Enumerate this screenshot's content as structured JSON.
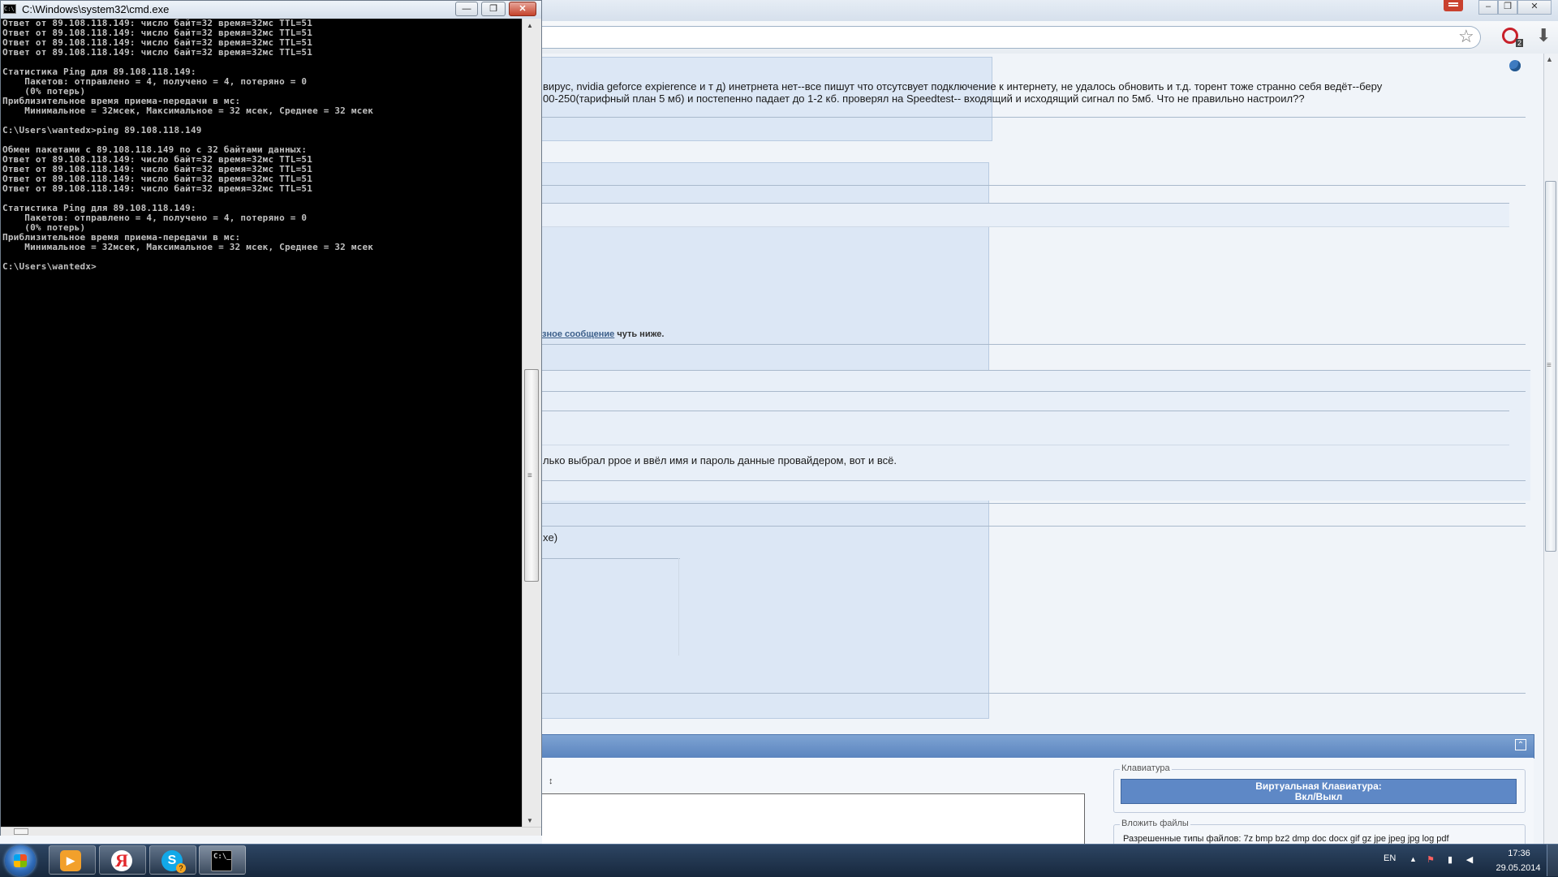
{
  "cmd": {
    "title": "C:\\Windows\\system32\\cmd.exe",
    "icon_label": "C:\\",
    "buttons": {
      "minimize": "—",
      "maximize": "❐",
      "close": "✕"
    },
    "lines": [
      "Ответ от 89.108.118.149: число байт=32 время=32мс TTL=51",
      "Ответ от 89.108.118.149: число байт=32 время=32мс TTL=51",
      "Ответ от 89.108.118.149: число байт=32 время=32мс TTL=51",
      "Ответ от 89.108.118.149: число байт=32 время=32мс TTL=51",
      "",
      "Статистика Ping для 89.108.118.149:",
      "    Пакетов: отправлено = 4, получено = 4, потеряно = 0",
      "    (0% потерь)",
      "Приблизительное время приема-передачи в мс:",
      "    Минимальное = 32мсек, Максимальное = 32 мсек, Среднее = 32 мсек",
      "",
      "C:\\Users\\wantedx>ping 89.108.118.149",
      "",
      "Обмен пакетами с 89.108.118.149 по с 32 байтами данных:",
      "Ответ от 89.108.118.149: число байт=32 время=32мс TTL=51",
      "Ответ от 89.108.118.149: число байт=32 время=32мс TTL=51",
      "Ответ от 89.108.118.149: число байт=32 время=32мс TTL=51",
      "Ответ от 89.108.118.149: число байт=32 время=32мс TTL=51",
      "",
      "Статистика Ping для 89.108.118.149:",
      "    Пакетов: отправлено = 4, получено = 4, потеряно = 0",
      "    (0% потерь)",
      "Приблизительное время приема-передачи в мс:",
      "    Минимальное = 32мсек, Максимальное = 32 мсек, Среднее = 32 мсек",
      "",
      "C:\\Users\\wantedx>"
    ]
  },
  "browser": {
    "star": "☆",
    "download": "⬇",
    "adblock_count": "2",
    "post": {
      "line1": "вирус, nvidia geforce expierence и т д) инетрнета нет--все пишут что отсутсвует подключение к интернету, не удалось обновить и т.д. торент тоже странно себя ведёт--беру",
      "line2": "00-250(тарифный план 5 мб) и постепенно падает до 1-2 кб. проверял на Speedtest-- входящий и исходящий сигнал по 5мб. Что не правильно настроил??"
    },
    "hint": {
      "link": "зное сообщение",
      "rest": " чуть ниже."
    },
    "reply_text": "лько выбрал ppoe и ввёл имя и пароль данные провайдером, вот и всё.",
    "fragment": "xe)",
    "keyboard": {
      "legend": "Клавиатура",
      "button_line1": "Виртуальная Клавиатура:",
      "button_line2": "Вкл/Выкл"
    },
    "attach": {
      "legend": "Вложить файлы",
      "allowed": "Разрешенные типы файлов: 7z bmp bz2 dmp doc docx gif gz jpe jpeg jpg log pdf"
    },
    "resize_arrows": "↕",
    "collapse": "⌃"
  },
  "taskbar": {
    "yandex": "Я",
    "skype": "S",
    "skype_badge": "?",
    "cmd_icon": "C:\\_",
    "lang": "EN",
    "time": "17:36",
    "date": "29.05.2014"
  }
}
